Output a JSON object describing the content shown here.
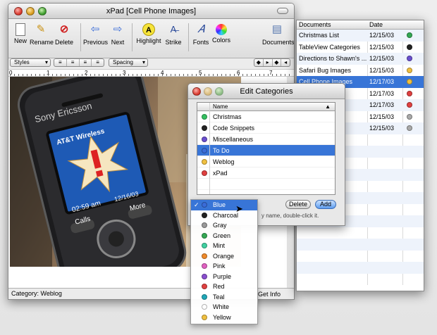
{
  "main_window": {
    "title": "xPad [Cell Phone Images]",
    "toolbar": [
      {
        "label": "New",
        "icon": "new-document-icon",
        "glyph": "📄"
      },
      {
        "label": "Rename",
        "icon": "pencil-icon",
        "glyph": "✎"
      },
      {
        "label": "Delete",
        "icon": "delete-icon",
        "glyph": "⊘"
      },
      {
        "label": "Previous",
        "icon": "arrow-left-icon",
        "glyph": "⇦"
      },
      {
        "label": "Next",
        "icon": "arrow-right-icon",
        "glyph": "⇨"
      },
      {
        "label": "Highlight",
        "icon": "highlight-icon",
        "glyph": "A"
      },
      {
        "label": "Strike",
        "icon": "strike-icon",
        "glyph": "A̶"
      },
      {
        "label": "Fonts",
        "icon": "fonts-icon",
        "glyph": "𝐴"
      },
      {
        "label": "Colors",
        "icon": "colors-icon",
        "glyph": "◉"
      },
      {
        "label": "Documents",
        "icon": "documents-icon",
        "glyph": "▤"
      }
    ],
    "format": {
      "styles": "Styles",
      "spacing": "Spacing"
    },
    "ruler": [
      "0",
      "1",
      "2",
      "3",
      "4",
      "5",
      "6",
      "7"
    ],
    "status": "Category: Weblog",
    "get_info": "Get Info"
  },
  "documents": {
    "col_name": "Documents",
    "col_date": "Date",
    "rows": [
      {
        "name": "Christmas List",
        "date": "12/15/03",
        "color": "#34a853"
      },
      {
        "name": "TableView Categories",
        "date": "12/15/03",
        "color": "#222222"
      },
      {
        "name": "Directions to Shawn's ...",
        "date": "12/15/03",
        "color": "#6a4fcf"
      },
      {
        "name": "Safari Bug Images",
        "date": "12/15/03",
        "color": "#f0c040"
      },
      {
        "name": "Cell Phone Images",
        "date": "12/17/03",
        "color": "#f0c040",
        "selected": true
      },
      {
        "name": "",
        "date": "12/17/03",
        "color": "#e04040"
      },
      {
        "name": "",
        "date": "12/17/03",
        "color": "#e04040"
      },
      {
        "name": "",
        "date": "12/15/03",
        "color": "#aaaaaa"
      },
      {
        "name": "",
        "date": "12/15/03",
        "color": "#aaaaaa"
      }
    ]
  },
  "edit_categories": {
    "title": "Edit Categories",
    "col_name": "Name",
    "rows": [
      {
        "name": "Christmas",
        "color": "#34c060"
      },
      {
        "name": "Code Snippets",
        "color": "#222222"
      },
      {
        "name": "Miscellaneous",
        "color": "#6a4fcf"
      },
      {
        "name": "To Do",
        "color": "#3a6cd8",
        "selected": true
      },
      {
        "name": "Weblog",
        "color": "#f0c040"
      },
      {
        "name": "xPad",
        "color": "#e04040"
      }
    ],
    "hint": "y name, double-click it.",
    "delete_label": "Delete",
    "add_label": "Add"
  },
  "color_menu": {
    "checkmark": "✓",
    "items": [
      {
        "label": "Blue",
        "color": "#3a6cd8",
        "selected": true
      },
      {
        "label": "Charcoal",
        "color": "#222222"
      },
      {
        "label": "Gray",
        "color": "#999999"
      },
      {
        "label": "Green",
        "color": "#34a853"
      },
      {
        "label": "Mint",
        "color": "#40d0a0"
      },
      {
        "label": "Orange",
        "color": "#f08a2a"
      },
      {
        "label": "Pink",
        "color": "#e060c0"
      },
      {
        "label": "Purple",
        "color": "#8a4fcf"
      },
      {
        "label": "Red",
        "color": "#e04040"
      },
      {
        "label": "Teal",
        "color": "#20a8b8"
      },
      {
        "label": "White",
        "color": "#ffffff"
      },
      {
        "label": "Yellow",
        "color": "#f0c040"
      }
    ]
  },
  "photo": {
    "brand": "Sony Ericsson",
    "carrier": "AT&T Wireless",
    "time": "02:59 am",
    "date": "12/16/03",
    "left_softkey": "Calls",
    "right_softkey": "More"
  }
}
